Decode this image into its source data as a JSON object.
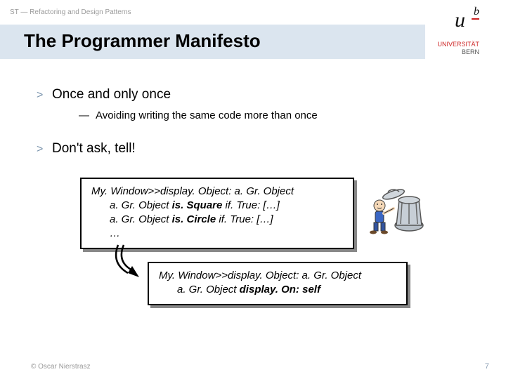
{
  "breadcrumb": "ST — Refactoring and Design Patterns",
  "title": "The Programmer Manifesto",
  "logo": {
    "u": "u",
    "b": "b",
    "line1": "UNIVERSITÄT",
    "line2": "BERN"
  },
  "bullets": [
    {
      "marker": ">",
      "text": "Once and only once",
      "sub_marker": "—",
      "sub_text": "Avoiding writing the same code more than once"
    },
    {
      "marker": ">",
      "text": "Don't ask, tell!"
    }
  ],
  "code_before": {
    "l1a": "My. Window>>display. Object: a. Gr. Object",
    "l2a": "a. Gr. Object ",
    "l2b": "is. Square",
    "l2c": " if. True: […]",
    "l3a": "a. Gr. Object ",
    "l3b": "is. Circle",
    "l3c": " if. True: […]",
    "l4": "…"
  },
  "code_after": {
    "l1": "My. Window>>display. Object: a. Gr. Object",
    "l2a": "a. Gr. Object ",
    "l2b": "display. On: self"
  },
  "footer": {
    "copyright": "© Oscar Nierstrasz",
    "page": "7"
  }
}
